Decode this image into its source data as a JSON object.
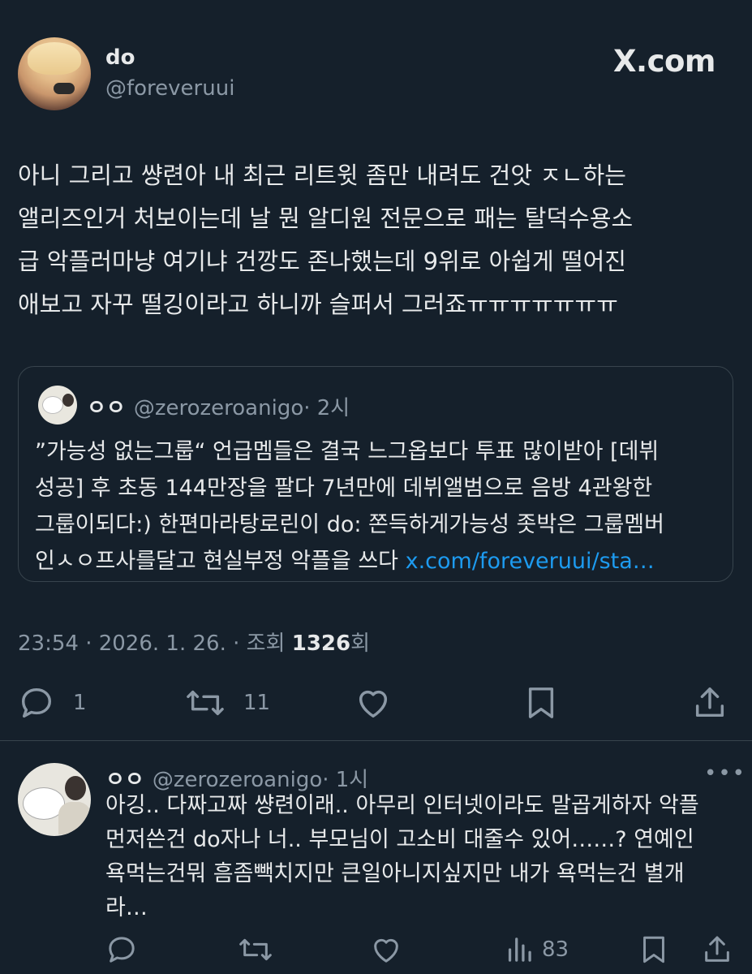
{
  "main_tweet": {
    "author_name": "do",
    "author_handle": "@foreveruui",
    "brand": "X.com",
    "text": "아니 그리고 썅련아 내 최근 리트윗 좀만 내려도 건앗 ㅈㄴ하는\n앨리즈인거 처보이는데 날 뭔 알디원 전문으로 패는 탈덕수용소\n급 악플러마냥 여기냐  건깡도 존나했는데 9위로 아쉽게 떨어진\n애보고 자꾸 떨깅이라고 하니까 슬퍼서 그러죠ㅠㅠㅠㅠㅠㅠㅠ",
    "timestamp": "23:54 · 2026. 1. 26. · 조회 ",
    "views": "1326",
    "views_suffix": "회",
    "replies": "1",
    "retweets": "11"
  },
  "quote": {
    "author_name": "ㅇㅇ",
    "author_handle": "@zerozeroanigo",
    "time": "· 2시",
    "text": "”가능성 없는그룹“ 언급멤들은 결국 느그옵보다 투표 많이받아 [데뷔\n성공] 후 초동 144만장을 팔다 7년만에 데뷔앨범으로 음방 4관왕한\n그룹이되다:) 한편마라탕로린이 do: 쫀득하게가능성 좃박은 그룹멤버\n인ㅅㅇ프사를달고 현실부정 악플을 쓰다 ",
    "link": "x.com/foreveruui/sta…"
  },
  "reply": {
    "author_name": "ㅇㅇ",
    "author_handle": "@zerozeroanigo",
    "time": "· 1시",
    "more": "•••",
    "text": "아깅.. 다짜고짜 썅련이래.. 아무리 인터넷이라도 말곱게하자 악플\n먼저쓴건 do자나 너.. 부모님이 고소비 대줄수 있어……? 연예인\n욕먹는건뭐 흠좀빽치지만 큰일아니지싶지만 내가 욕먹는건 별개\n라…",
    "views": "83"
  },
  "colors": {
    "background": "#15202b",
    "text": "#e7e9ea",
    "secondary": "#8b98a5",
    "link": "#1d9bf0",
    "border": "#38444d"
  },
  "icons": [
    "reply-icon",
    "retweet-icon",
    "like-icon",
    "bookmark-icon",
    "share-icon",
    "views-icon"
  ]
}
